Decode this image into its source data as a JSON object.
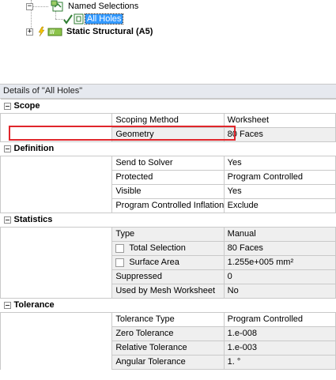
{
  "tree": {
    "named_selections": "Named Selections",
    "all_holes": "All Holes",
    "static_structural": "Static Structural (A5)"
  },
  "details": {
    "title": "Details of \"All Holes\"",
    "sections": {
      "scope": "Scope",
      "definition": "Definition",
      "statistics": "Statistics",
      "tolerance": "Tolerance"
    },
    "rows": {
      "scoping_method": [
        "Scoping Method",
        "Worksheet"
      ],
      "geometry": [
        "Geometry",
        "80 Faces"
      ],
      "send_to_solver": [
        "Send to Solver",
        "Yes"
      ],
      "protected": [
        "Protected",
        "Program Controlled"
      ],
      "visible": [
        "Visible",
        "Yes"
      ],
      "pci": [
        "Program Controlled Inflation",
        "Exclude"
      ],
      "type": [
        "Type",
        "Manual"
      ],
      "total_selection": [
        "Total Selection",
        "80 Faces"
      ],
      "surface_area": [
        "Surface Area",
        "1.255e+005 mm²"
      ],
      "suppressed": [
        "Suppressed",
        "0"
      ],
      "mesh_ws": [
        "Used by Mesh Worksheet",
        "No"
      ],
      "tol_type": [
        "Tolerance Type",
        "Program Controlled"
      ],
      "zero_tol": [
        "Zero Tolerance",
        "1.e-008"
      ],
      "rel_tol": [
        "Relative Tolerance",
        "1.e-003"
      ],
      "ang_tol": [
        "Angular Tolerance",
        "1. °"
      ]
    }
  }
}
